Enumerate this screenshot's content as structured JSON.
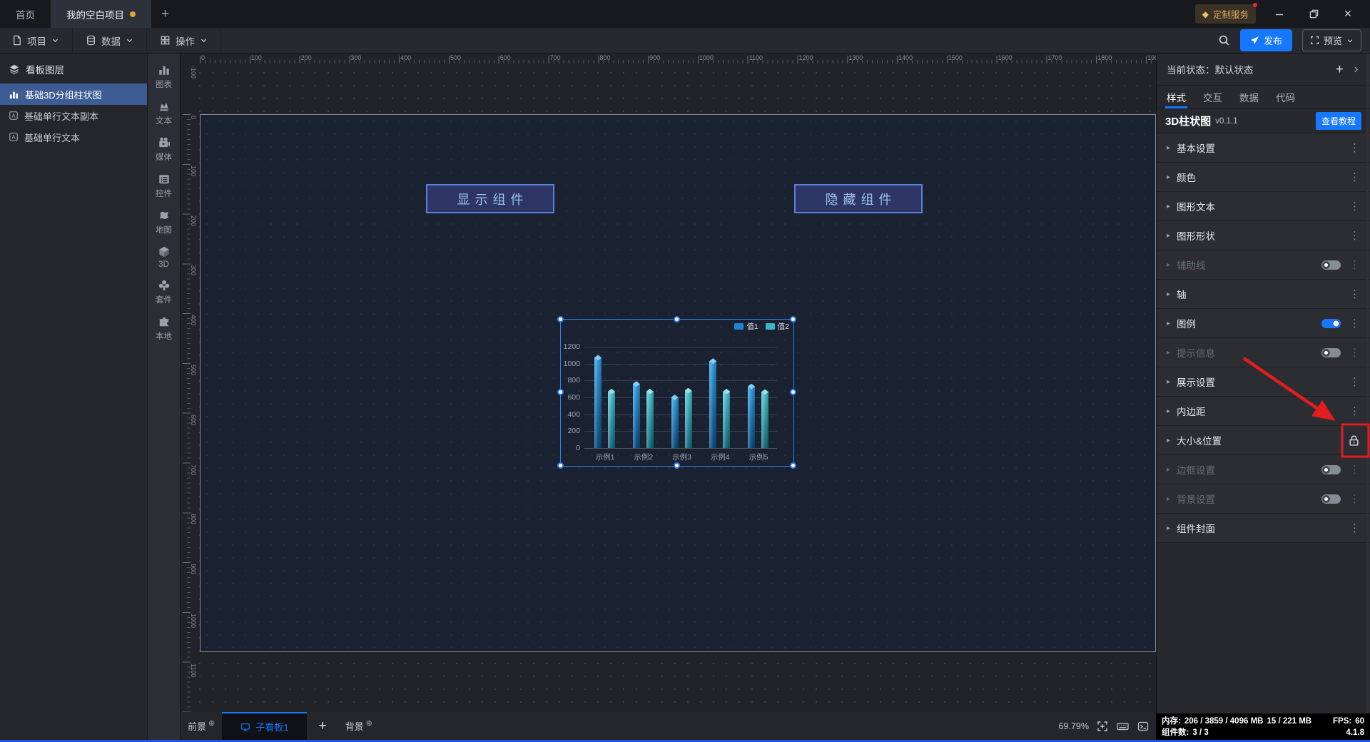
{
  "app": {
    "tabs": [
      {
        "label": "首页"
      },
      {
        "label": "我的空白项目",
        "modified": true
      }
    ],
    "new_tab_label": "+",
    "badge": {
      "label": "定制服务",
      "diamond_icon": "diamond-icon",
      "has_red_dot": true
    },
    "menus": [
      {
        "label": "项目"
      },
      {
        "label": "数据"
      },
      {
        "label": "操作"
      }
    ],
    "publish_label": "发布",
    "preview_label": "预览"
  },
  "layers_panel": {
    "title": "看板图层",
    "items": [
      {
        "label": "基础3D分组柱状图",
        "icon": "bar-chart-icon",
        "selected": true
      },
      {
        "label": "基础单行文本副本",
        "icon": "text-icon",
        "selected": false
      },
      {
        "label": "基础单行文本",
        "icon": "text-icon",
        "selected": false
      }
    ]
  },
  "component_dock": {
    "items": [
      {
        "label": "图表",
        "icon": "chart-icon"
      },
      {
        "label": "文本",
        "icon": "text-brush-icon"
      },
      {
        "label": "媒体",
        "icon": "media-icon"
      },
      {
        "label": "控件",
        "icon": "widget-icon"
      },
      {
        "label": "地图",
        "icon": "map-icon"
      },
      {
        "label": "3D",
        "icon": "cube-icon"
      },
      {
        "label": "套件",
        "icon": "kit-icon"
      },
      {
        "label": "本地",
        "icon": "puzzle-icon"
      }
    ]
  },
  "canvas": {
    "h_ruler": {
      "start": 0,
      "end": 1900,
      "step": 100
    },
    "v_ruler": {
      "start": -100,
      "end": 1100,
      "step": 100
    },
    "text_components": [
      {
        "label": "显示组件"
      },
      {
        "label": "隐藏组件"
      }
    ]
  },
  "chart_data": {
    "type": "bar",
    "style": "3d-grouped-column",
    "categories": [
      "示例1",
      "示例2",
      "示例3",
      "示例4",
      "示例5"
    ],
    "series": [
      {
        "name": "值1",
        "color": "#1f85cf",
        "values": [
          1070,
          760,
          600,
          1030,
          730
        ]
      },
      {
        "name": "值2",
        "color": "#3fb6c5",
        "values": [
          670,
          670,
          680,
          670,
          665
        ]
      }
    ],
    "title": "",
    "xlabel": "",
    "ylabel": "",
    "ylim": [
      0,
      1200
    ],
    "yticks": [
      0,
      200,
      400,
      600,
      800,
      1000,
      1200
    ],
    "grid": true,
    "legend_position": "top-right"
  },
  "inspector": {
    "state_label": "当前状态：默认状态",
    "add_state_label": "+",
    "tabs": [
      {
        "label": "样式",
        "active": true
      },
      {
        "label": "交互"
      },
      {
        "label": "数据"
      },
      {
        "label": "代码"
      }
    ],
    "component": {
      "name": "3D柱状图",
      "version": "v0.1.1",
      "tutorial_label": "查看教程"
    },
    "sections": [
      {
        "label": "基本设置"
      },
      {
        "label": "颜色"
      },
      {
        "label": "图形文本"
      },
      {
        "label": "图形形状"
      },
      {
        "label": "辅助线",
        "disabled": true,
        "toggle": "off"
      },
      {
        "label": "轴"
      },
      {
        "label": "图例",
        "toggle": "on"
      },
      {
        "label": "提示信息",
        "disabled": true,
        "toggle": "off"
      },
      {
        "label": "展示设置"
      },
      {
        "label": "内边距"
      },
      {
        "label": "大小&位置",
        "lock": true,
        "highlighted": true
      },
      {
        "label": "边框设置",
        "disabled": true,
        "toggle": "off"
      },
      {
        "label": "背景设置",
        "disabled": true,
        "toggle": "off"
      },
      {
        "label": "组件封面"
      }
    ]
  },
  "bottom_bar": {
    "foreground_label": "前景",
    "board_tab_label": "子看板1",
    "add_board_label": "+",
    "background_label": "背景",
    "zoom_level": "69.79%"
  },
  "status_box": {
    "memory_label": "内存:",
    "memory_value": "206 / 3859 / 4096 MB",
    "memory_extra": "15 / 221 MB",
    "fps_label": "FPS:",
    "fps_value": "60",
    "components_label": "组件数:",
    "components_value": "3 / 3",
    "app_version": "4.1.8"
  },
  "colors": {
    "accent": "#1677ff",
    "selection": "#2f7ff2",
    "annotation_red": "#e11d1d",
    "series1_top": "#35a2e6",
    "series1_bottom": "#0d4f85",
    "series1_cap": "#7dd0f7",
    "series2_top": "#52c8d4",
    "series2_bottom": "#17707f",
    "series2_cap": "#93e2e8",
    "text_button_border": "#5b82d8",
    "unsaved_dot": "#e2a23e"
  }
}
